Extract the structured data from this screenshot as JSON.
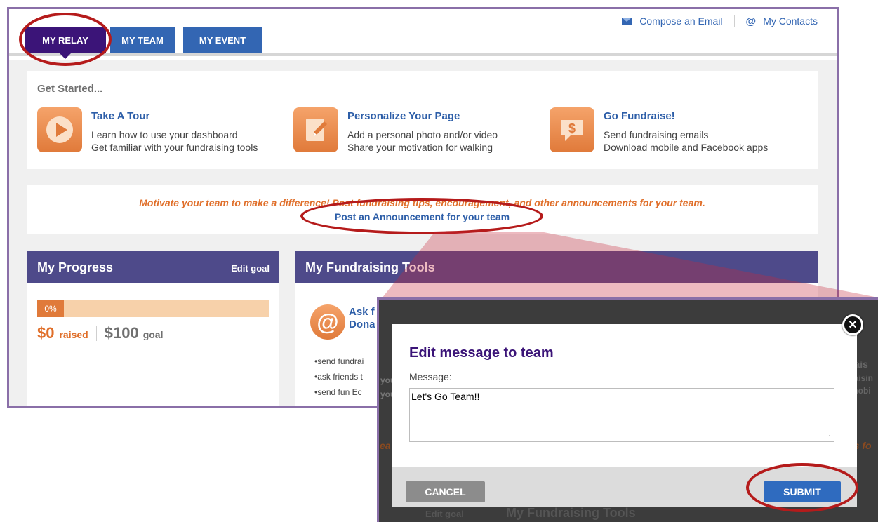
{
  "toplinks": {
    "compose": "Compose an Email",
    "contacts": "My Contacts"
  },
  "tabs": [
    "MY RELAY",
    "MY TEAM",
    "MY EVENT"
  ],
  "get_started": {
    "title": "Get Started...",
    "items": [
      {
        "icon": "play-icon",
        "heading": "Take A Tour",
        "lines": [
          "Learn how to use your dashboard",
          "Get familiar with your fundraising tools"
        ]
      },
      {
        "icon": "pencil-icon",
        "heading": "Personalize Your Page",
        "lines": [
          "Add a personal photo and/or video",
          "Share your motivation for walking"
        ]
      },
      {
        "icon": "dollar-icon",
        "heading": "Go Fundraise!",
        "lines": [
          "Send fundraising emails",
          "Download mobile and Facebook apps"
        ]
      }
    ]
  },
  "announcement": {
    "motivate": "Motivate your team to make a difference! Post fundraising tips, encouragement, and other announcements for your team.",
    "link": "Post an Announcement for your team"
  },
  "progress": {
    "title": "My Progress",
    "edit": "Edit goal",
    "percent_label": "0%",
    "percent": 0,
    "raised_amount": "$0",
    "raised_label": "raised",
    "goal_amount": "$100",
    "goal_label": "goal"
  },
  "tools": {
    "title": "My Fundraising Tools",
    "ask_line1": "Ask f",
    "ask_line2": "Dona",
    "bullets": [
      "•send fundrai",
      "•ask friends t",
      "•send fun Ec"
    ]
  },
  "background_fragments": {
    "raise": "rais",
    "raisin": "raisin",
    "mobi": "mobi",
    "you1": "you",
    "you2": "you",
    "ts_f": "ts fo",
    "ea": "ea",
    "edit_goal": "Edit goal",
    "tools_title": "My Fundraising Tools"
  },
  "modal": {
    "title": "Edit message to team",
    "label": "Message:",
    "message": "Let's Go Team!!",
    "cancel": "CANCEL",
    "submit": "SUBMIT",
    "close_icon": "close-icon"
  },
  "colors": {
    "accent_purple": "#3b1478",
    "tab_blue": "#3366b3",
    "orange": "#e06f2a",
    "panel_header": "#4e4a8a",
    "highlight_ring": "#b51b1b"
  }
}
